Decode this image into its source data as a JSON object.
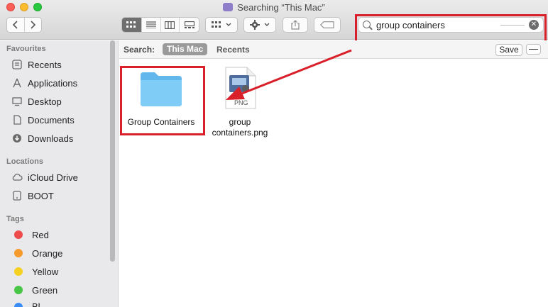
{
  "window": {
    "title": "Searching “This Mac”"
  },
  "search": {
    "value": "group containers",
    "clear_glyph": "✕"
  },
  "scope_bar": {
    "search_label": "Search:",
    "this_mac": "This Mac",
    "recents": "Recents",
    "save_label": "Save",
    "minus_label": "—"
  },
  "sidebar": {
    "favourites_header": "Favourites",
    "favourites": [
      {
        "label": "Recents",
        "icon": "clock-icon"
      },
      {
        "label": "Applications",
        "icon": "applications-icon"
      },
      {
        "label": "Desktop",
        "icon": "desktop-icon"
      },
      {
        "label": "Documents",
        "icon": "document-icon"
      },
      {
        "label": "Downloads",
        "icon": "download-icon"
      }
    ],
    "locations_header": "Locations",
    "locations": [
      {
        "label": "iCloud Drive",
        "icon": "cloud-icon"
      },
      {
        "label": "BOOT",
        "icon": "disk-icon"
      }
    ],
    "tags_header": "Tags",
    "tags": [
      {
        "label": "Red",
        "color": "#ee4b4b"
      },
      {
        "label": "Orange",
        "color": "#f69a2c"
      },
      {
        "label": "Yellow",
        "color": "#f5d020"
      },
      {
        "label": "Green",
        "color": "#48c648"
      },
      {
        "label": "Bl",
        "color": "#3b8cf6"
      }
    ]
  },
  "results": [
    {
      "name": "Group Containers",
      "kind": "folder"
    },
    {
      "name_line1": "group",
      "name_line2": "containers.png",
      "badge": "PNG",
      "kind": "png"
    }
  ],
  "annotation": {
    "color": "#d9202a"
  }
}
